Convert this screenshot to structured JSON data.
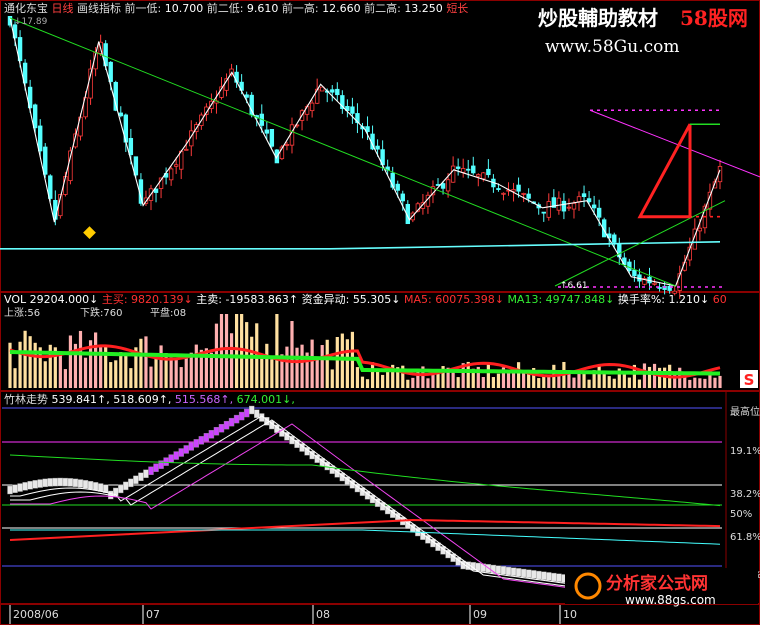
{
  "header": {
    "stock_name": "通化东宝",
    "period": "日线",
    "indicator": "画线指标",
    "info": [
      {
        "label": "前一低:",
        "value": "10.700"
      },
      {
        "label": "前二低:",
        "value": "9.610"
      },
      {
        "label": "前一高:",
        "value": "12.660"
      },
      {
        "label": "前二高:",
        "value": "13.250"
      }
    ],
    "info_tail": "短长",
    "top_price": "17.89",
    "low_price": "6.61"
  },
  "watermark_top": {
    "title": "炒股輔助教材",
    "brand": "58股网",
    "url": "www.58Gu.com"
  },
  "watermark_bottom": {
    "title": "分析家公式网",
    "url": "www.88gs.com"
  },
  "volume_panel": {
    "line1": [
      {
        "label": "VOL",
        "value": "29204.000",
        "arrow": "↓",
        "color": "#ffffff"
      },
      {
        "label": "主买:",
        "value": "9820.139",
        "arrow": "↓",
        "color": "#ff3030"
      },
      {
        "label": "主卖:",
        "value": "-19583.863",
        "arrow": "↑",
        "color": "#ffffff"
      },
      {
        "label": "资金异动:",
        "value": "55.305",
        "arrow": "↓",
        "color": "#ffffff"
      },
      {
        "label": "MA5:",
        "value": "60075.398",
        "arrow": "↓",
        "color": "#ff3030"
      },
      {
        "label": "MA13:",
        "value": "49747.848",
        "arrow": "↓",
        "color": "#33ee33"
      },
      {
        "label": "换手率%:",
        "value": "1.210",
        "arrow": "↓",
        "color": "#ffffff"
      }
    ],
    "line1_tail": "60",
    "up_label": "上涨:56",
    "down_label": "下跌:760",
    "flat_label": "平盘:08",
    "s_badge": "S"
  },
  "trend_panel": {
    "title": "竹林走势",
    "values": [
      {
        "value": "539.841",
        "arrow": "↑",
        "color": "#ffffff"
      },
      {
        "value": "518.609",
        "arrow": "↑",
        "color": "#ffffff"
      },
      {
        "value": "515.568",
        "arrow": "↑",
        "color": "#cc66ff"
      },
      {
        "value": "674.001",
        "arrow": "↓",
        "color": "#33ee33"
      }
    ],
    "levels": [
      "最高位",
      "19.1%",
      "38.2%",
      "50%",
      "61.8%",
      "80.9%"
    ]
  },
  "xaxis": {
    "labels": [
      "2008/06",
      "07",
      "08",
      "09",
      "10"
    ]
  },
  "colors": {
    "up": "#ff3b3b",
    "down": "#54ffff",
    "grid": "#8b0000",
    "magenta": "#ff33ff",
    "green": "#22dd22"
  },
  "chart_data": [
    {
      "type": "candlestick",
      "title": "通化东宝 日线",
      "y_range": [
        6.61,
        17.89
      ],
      "zigzag_turning_points": [
        17.89,
        9.3,
        16.9,
        10.0,
        12.66,
        15.6,
        12.0,
        15.1,
        13.2,
        9.4,
        11.5,
        10.9,
        9.9,
        10.2,
        7.0,
        6.61,
        11.5
      ],
      "triangle_top": 13.25,
      "triangle_bottom": 9.61,
      "support_line": 8.3
    },
    {
      "type": "bar",
      "title": "VOL",
      "series": [
        {
          "name": "MA5",
          "values": [
            60075.398
          ]
        },
        {
          "name": "MA13",
          "values": [
            49747.848
          ]
        }
      ],
      "last_volume": 29204.0
    },
    {
      "type": "line",
      "title": "竹林走势",
      "series": [
        {
          "values": [
            539.841
          ]
        },
        {
          "values": [
            518.609
          ]
        },
        {
          "values": [
            515.568
          ]
        },
        {
          "values": [
            674.001
          ]
        }
      ]
    }
  ]
}
